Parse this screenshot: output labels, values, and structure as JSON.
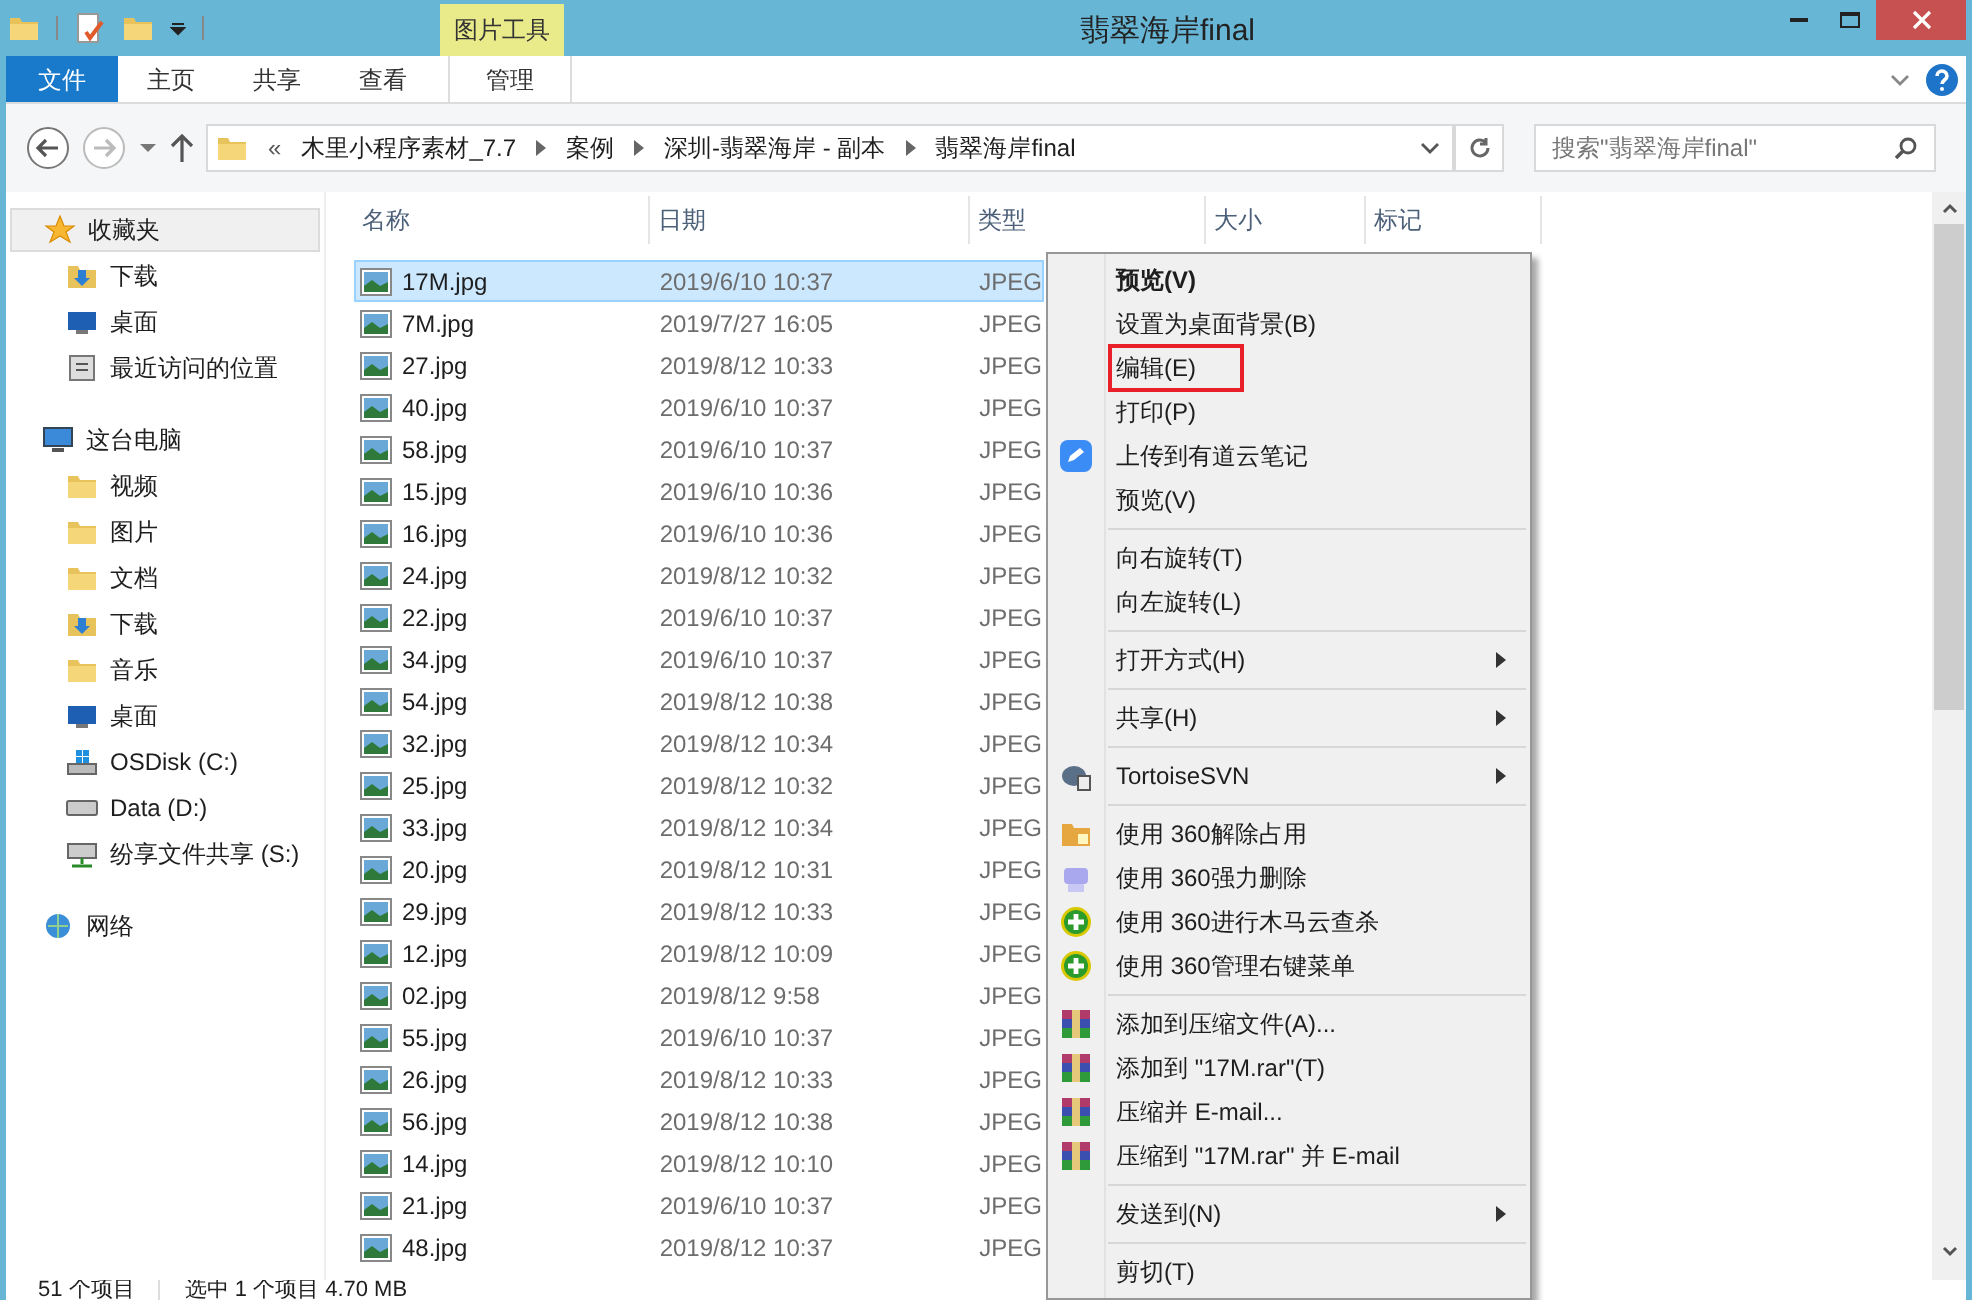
{
  "window": {
    "title": "翡翠海岸final",
    "context_tab": "图片工具"
  },
  "ribbon_tabs": [
    {
      "label": "文件",
      "selected": true,
      "kind": "file"
    },
    {
      "label": "主页",
      "selected": false,
      "kind": "tab"
    },
    {
      "label": "共享",
      "selected": false,
      "kind": "tab"
    },
    {
      "label": "查看",
      "selected": false,
      "kind": "tab"
    },
    {
      "label": "管理",
      "selected": false,
      "kind": "context"
    }
  ],
  "address": {
    "overflow": "«",
    "crumbs": [
      "木里小程序素材_7.7",
      "案例",
      "深圳-翡翠海岸 - 副本",
      "翡翠海岸final"
    ]
  },
  "search": {
    "placeholder": "搜索\"翡翠海岸final\""
  },
  "sidebar": [
    {
      "label": "收藏夹",
      "kind": "star",
      "selected": true,
      "children": [
        {
          "label": "下载",
          "kind": "download",
          "selected": false
        },
        {
          "label": "桌面",
          "kind": "desktop",
          "selected": false
        },
        {
          "label": "最近访问的位置",
          "kind": "recent",
          "selected": false
        }
      ]
    },
    {
      "label": "这台电脑",
      "kind": "pc",
      "selected": false,
      "children": [
        {
          "label": "视频",
          "kind": "folder",
          "selected": false
        },
        {
          "label": "图片",
          "kind": "folder",
          "selected": false
        },
        {
          "label": "文档",
          "kind": "folder",
          "selected": false
        },
        {
          "label": "下载",
          "kind": "download",
          "selected": false
        },
        {
          "label": "音乐",
          "kind": "folder",
          "selected": false
        },
        {
          "label": "桌面",
          "kind": "desktop",
          "selected": false
        },
        {
          "label": "OSDisk (C:)",
          "kind": "windisk",
          "selected": false
        },
        {
          "label": "Data (D:)",
          "kind": "disk",
          "selected": false
        },
        {
          "label": "纷享文件共享 (S:)",
          "kind": "netdisk",
          "selected": false
        }
      ]
    },
    {
      "label": "网络",
      "kind": "network",
      "selected": false
    }
  ],
  "table": {
    "columns": [
      "名称",
      "日期",
      "类型",
      "大小",
      "标记"
    ],
    "rows": [
      {
        "name": "17M.jpg",
        "date": "2019/6/10 10:37",
        "type": "JPEG",
        "selected": true
      },
      {
        "name": "7M.jpg",
        "date": "2019/7/27 16:05",
        "type": "JPEG",
        "selected": false
      },
      {
        "name": "27.jpg",
        "date": "2019/8/12 10:33",
        "type": "JPEG",
        "selected": false
      },
      {
        "name": "40.jpg",
        "date": "2019/6/10 10:37",
        "type": "JPEG",
        "selected": false
      },
      {
        "name": "58.jpg",
        "date": "2019/6/10 10:37",
        "type": "JPEG",
        "selected": false
      },
      {
        "name": "15.jpg",
        "date": "2019/6/10 10:36",
        "type": "JPEG",
        "selected": false
      },
      {
        "name": "16.jpg",
        "date": "2019/6/10 10:36",
        "type": "JPEG",
        "selected": false
      },
      {
        "name": "24.jpg",
        "date": "2019/8/12 10:32",
        "type": "JPEG",
        "selected": false
      },
      {
        "name": "22.jpg",
        "date": "2019/6/10 10:37",
        "type": "JPEG",
        "selected": false
      },
      {
        "name": "34.jpg",
        "date": "2019/6/10 10:37",
        "type": "JPEG",
        "selected": false
      },
      {
        "name": "54.jpg",
        "date": "2019/8/12 10:38",
        "type": "JPEG",
        "selected": false
      },
      {
        "name": "32.jpg",
        "date": "2019/8/12 10:34",
        "type": "JPEG",
        "selected": false
      },
      {
        "name": "25.jpg",
        "date": "2019/8/12 10:32",
        "type": "JPEG",
        "selected": false
      },
      {
        "name": "33.jpg",
        "date": "2019/8/12 10:34",
        "type": "JPEG",
        "selected": false
      },
      {
        "name": "20.jpg",
        "date": "2019/8/12 10:31",
        "type": "JPEG",
        "selected": false
      },
      {
        "name": "29.jpg",
        "date": "2019/8/12 10:33",
        "type": "JPEG",
        "selected": false
      },
      {
        "name": "12.jpg",
        "date": "2019/8/12 10:09",
        "type": "JPEG",
        "selected": false
      },
      {
        "name": "02.jpg",
        "date": "2019/8/12 9:58",
        "type": "JPEG",
        "selected": false
      },
      {
        "name": "55.jpg",
        "date": "2019/6/10 10:37",
        "type": "JPEG",
        "selected": false
      },
      {
        "name": "26.jpg",
        "date": "2019/8/12 10:33",
        "type": "JPEG",
        "selected": false
      },
      {
        "name": "56.jpg",
        "date": "2019/8/12 10:38",
        "type": "JPEG",
        "selected": false
      },
      {
        "name": "14.jpg",
        "date": "2019/8/12 10:10",
        "type": "JPEG",
        "selected": false
      },
      {
        "name": "21.jpg",
        "date": "2019/6/10 10:37",
        "type": "JPEG",
        "selected": false
      },
      {
        "name": "48.jpg",
        "date": "2019/8/12 10:37",
        "type": "JPEG",
        "selected": false
      }
    ]
  },
  "context_menu": [
    {
      "kind": "plain",
      "label": "预览(V)",
      "default": true,
      "highlighted": false,
      "submenu": false
    },
    {
      "kind": "plain",
      "label": "设置为桌面背景(B)",
      "default": false,
      "highlighted": false,
      "submenu": false
    },
    {
      "kind": "plain",
      "label": "编辑(E)",
      "default": false,
      "highlighted": true,
      "submenu": false
    },
    {
      "kind": "plain",
      "label": "打印(P)",
      "default": false,
      "highlighted": false,
      "submenu": false
    },
    {
      "kind": "note",
      "label": "上传到有道云笔记",
      "default": false,
      "highlighted": false,
      "submenu": false
    },
    {
      "kind": "plain",
      "label": "预览(V)",
      "default": false,
      "highlighted": false,
      "submenu": false
    },
    {
      "kind": "separator"
    },
    {
      "kind": "plain",
      "label": "向右旋转(T)",
      "default": false,
      "highlighted": false,
      "submenu": false
    },
    {
      "kind": "plain",
      "label": "向左旋转(L)",
      "default": false,
      "highlighted": false,
      "submenu": false
    },
    {
      "kind": "separator"
    },
    {
      "kind": "plain",
      "label": "打开方式(H)",
      "default": false,
      "highlighted": false,
      "submenu": true
    },
    {
      "kind": "separator"
    },
    {
      "kind": "plain",
      "label": "共享(H)",
      "default": false,
      "highlighted": false,
      "submenu": true
    },
    {
      "kind": "separator"
    },
    {
      "kind": "svn",
      "label": "TortoiseSVN",
      "default": false,
      "highlighted": false,
      "submenu": true
    },
    {
      "kind": "separator"
    },
    {
      "kind": "unlock",
      "label": "使用 360解除占用",
      "default": false,
      "highlighted": false,
      "submenu": false
    },
    {
      "kind": "shred",
      "label": "使用 360强力删除",
      "default": false,
      "highlighted": false,
      "submenu": false
    },
    {
      "kind": "plus",
      "label": "使用 360进行木马云查杀",
      "default": false,
      "highlighted": false,
      "submenu": false
    },
    {
      "kind": "plus",
      "label": "使用 360管理右键菜单",
      "default": false,
      "highlighted": false,
      "submenu": false
    },
    {
      "kind": "separator"
    },
    {
      "kind": "archive",
      "label": "添加到压缩文件(A)...",
      "default": false,
      "highlighted": false,
      "submenu": false
    },
    {
      "kind": "archive",
      "label": "添加到 \"17M.rar\"(T)",
      "default": false,
      "highlighted": false,
      "submenu": false
    },
    {
      "kind": "archive",
      "label": "压缩并 E-mail...",
      "default": false,
      "highlighted": false,
      "submenu": false
    },
    {
      "kind": "archive",
      "label": "压缩到 \"17M.rar\" 并 E-mail",
      "default": false,
      "highlighted": false,
      "submenu": false
    },
    {
      "kind": "separator"
    },
    {
      "kind": "plain",
      "label": "发送到(N)",
      "default": false,
      "highlighted": false,
      "submenu": true
    },
    {
      "kind": "separator"
    },
    {
      "kind": "plain",
      "label": "剪切(T)",
      "default": false,
      "highlighted": false,
      "submenu": false
    }
  ],
  "status_bar": [
    "51 个项目",
    "选中 1 个项目 4.70 MB"
  ]
}
